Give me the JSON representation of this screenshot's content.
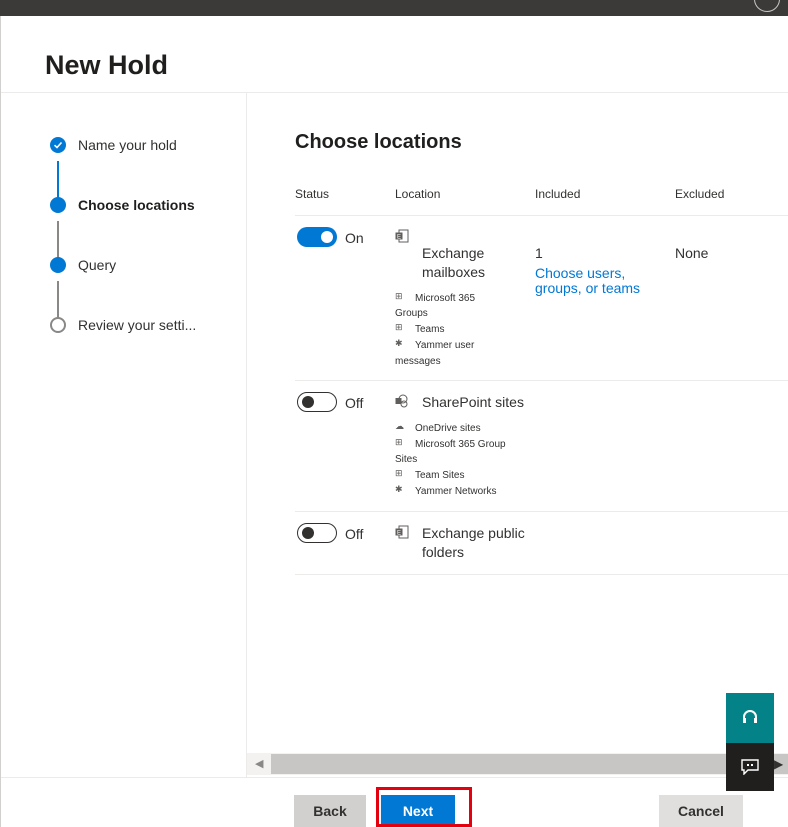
{
  "panel": {
    "title": "New Hold"
  },
  "steps": [
    {
      "label": "Name your hold",
      "state": "done"
    },
    {
      "label": "Choose locations",
      "state": "active"
    },
    {
      "label": "Query",
      "state": "pending"
    },
    {
      "label": "Review your setti...",
      "state": "empty"
    }
  ],
  "content": {
    "heading": "Choose locations",
    "columns": {
      "status": "Status",
      "location": "Location",
      "included": "Included",
      "excluded": "Excluded"
    },
    "rows": [
      {
        "toggle": "On",
        "icon": "exchange-icon",
        "location_line1": "Exchange",
        "location_line2": "mailboxes",
        "subs": [
          "Microsoft 365",
          "Groups",
          "Teams",
          "Yammer user",
          "messages"
        ],
        "included_count": "1",
        "included_link_line1": "Choose users,",
        "included_link_line2": "groups, or teams",
        "excluded": "None"
      },
      {
        "toggle": "Off",
        "icon": "sharepoint-icon",
        "location_line1": "SharePoint sites",
        "subs": [
          "OneDrive sites",
          "Microsoft 365 Group",
          "Sites",
          "Team Sites",
          "Yammer Networks"
        ]
      },
      {
        "toggle": "Off",
        "icon": "exchange-icon",
        "location_line1": "Exchange public",
        "location_line2": "folders"
      }
    ]
  },
  "footer": {
    "back": "Back",
    "next": "Next",
    "cancel": "Cancel"
  },
  "colors": {
    "accent": "#0078d4",
    "help": "#038387",
    "highlight": "#e3000f"
  }
}
